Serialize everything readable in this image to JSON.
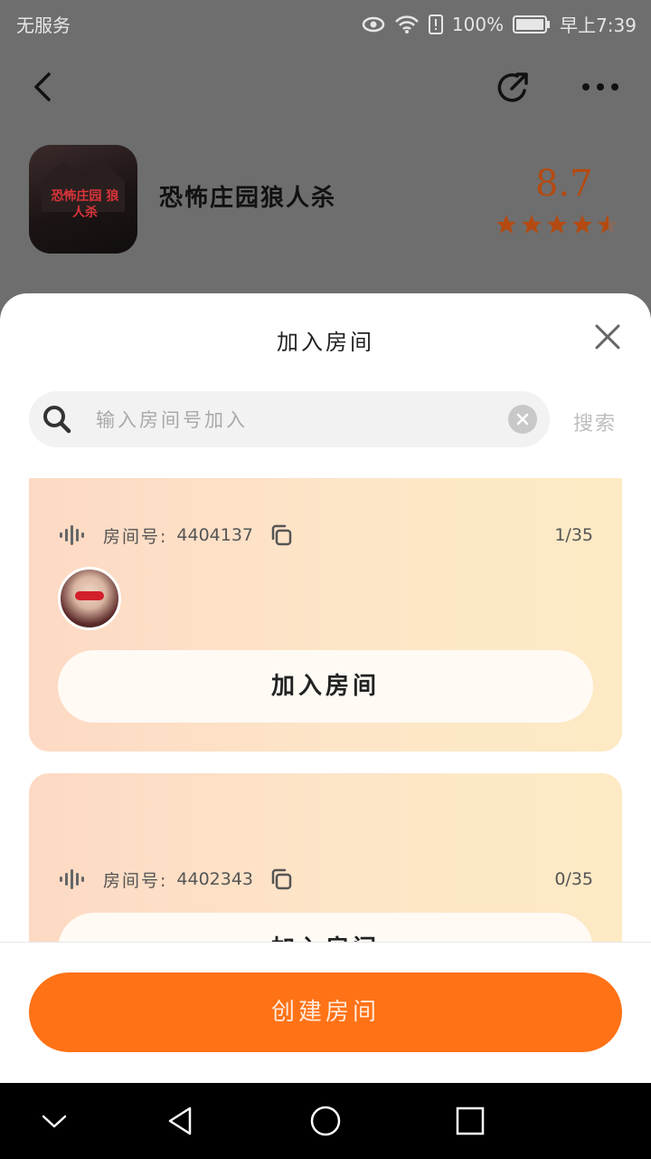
{
  "status_bar": {
    "carrier": "无服务",
    "battery": "100%",
    "time": "早上7:39"
  },
  "app_header": {
    "game_title": "恐怖庄园狼人杀",
    "icon_caption": "恐怖庄园 狼人杀",
    "rating": "8.7",
    "stars": 4.5
  },
  "sheet": {
    "title": "加入房间",
    "search": {
      "placeholder": "输入房间号加入",
      "value": "",
      "search_label": "搜索"
    },
    "rooms": [
      {
        "label": "房间号:",
        "room_id": "4404137",
        "count": "1/35",
        "join_label": "加入房间"
      },
      {
        "label": "房间号:",
        "room_id": "4402343",
        "count": "0/35",
        "join_label": "加入房间"
      }
    ],
    "create_label": "创建房间"
  },
  "colors": {
    "accent": "#ff7216",
    "rating": "#b44a11",
    "card_gradient_start": "#fdd9c4",
    "card_gradient_end": "#fdeac4"
  }
}
